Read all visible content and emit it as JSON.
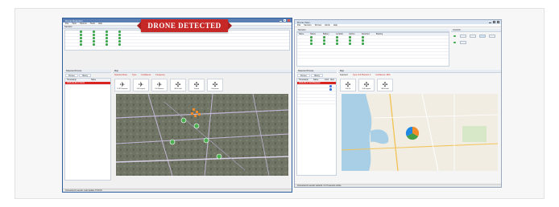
{
  "banner": {
    "text": "DRONE DETECTED"
  },
  "left_window": {
    "title": "Drone Detection",
    "menu": [
      "File",
      "View",
      "Options",
      "Tools",
      "Help"
    ],
    "sensors_panel": "Sensors",
    "drones_panel": "Detected Drones",
    "drones_tabs": [
      "Drones",
      "History"
    ],
    "drones_columns": [
      "Timestamp",
      "Name"
    ],
    "selected_row": "2016-04-28 17:04:01",
    "map_panel": "Map",
    "tile_labels": [
      "DJI Phantom",
      "DJI Inspire",
      "DJI Matrice",
      "3DR Solo",
      "Parrot",
      "Unknown"
    ],
    "detail_labels": {
      "selected": "Selected drone",
      "type": "Type",
      "confidence": "Confidence",
      "frequency": "Frequency"
    },
    "status": "Connected to sensor. Last update 17:04:01"
  },
  "right_window": {
    "title": "Drone View",
    "menu": [
      "File",
      "Sensors",
      "Drones",
      "Alerts",
      "Help"
    ],
    "sensors_panel": "Sensors",
    "sensors_columns": [
      "Name",
      "Status",
      "Battery",
      "Location",
      "Uptime",
      "Detected",
      "Bearing"
    ],
    "controls_panel": "Controls",
    "drones_panel": "Detected Drones",
    "drones_tabs": [
      "Drones",
      "History"
    ],
    "drones_columns": [
      "Timestamp",
      "Name",
      "Conf.",
      "Alert"
    ],
    "selected_row": "2016-05-17 DJI Phantom",
    "detail_labels": {
      "selected": "Selected:",
      "type": "Type: DJI Phantom 4",
      "confidence": "Confidence: 96%"
    },
    "tile_labels": [
      "DJI P4",
      "DJI Inspire",
      "3DR Solo"
    ],
    "map_panel": "Map",
    "status": "Connected to sensor network. 3 of 3 sensors online"
  },
  "colors": {
    "alert": "#c62828",
    "ok": "#3aa44a",
    "selection": "#d8241f"
  }
}
